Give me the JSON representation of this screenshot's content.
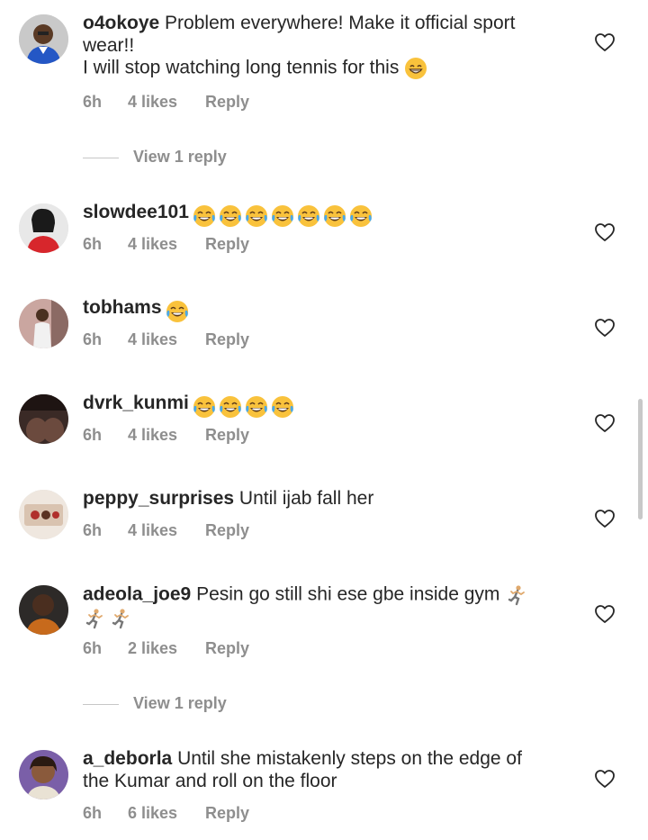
{
  "comments": [
    {
      "username": "o4okoye",
      "text_line1": "Problem everywhere! Make it official sport",
      "text_line2": "wear!!",
      "text_line3": "I will stop watching long tennis for this",
      "time": "6h",
      "likes": "4 likes",
      "reply": "Reply",
      "view_replies": "View 1 reply"
    },
    {
      "username": "slowdee101",
      "text": "",
      "time": "6h",
      "likes": "4 likes",
      "reply": "Reply"
    },
    {
      "username": "tobhams",
      "text": "",
      "time": "6h",
      "likes": "4 likes",
      "reply": "Reply"
    },
    {
      "username": "dvrk_kunmi",
      "text": "",
      "time": "6h",
      "likes": "4 likes",
      "reply": "Reply"
    },
    {
      "username": "peppy_surprises",
      "text": "Until ijab fall her",
      "time": "6h",
      "likes": "4 likes",
      "reply": "Reply"
    },
    {
      "username": "adeola_joe9",
      "text": "Pesin go still shi ese gbe inside gym",
      "time": "6h",
      "likes": "2 likes",
      "reply": "Reply",
      "view_replies": "View 1 reply"
    },
    {
      "username": "a_deborla",
      "text_line1": "Until she mistakenly steps on the edge of",
      "text_line2": "the Kumar and roll on the floor",
      "time": "6h",
      "likes": "6 likes",
      "reply": "Reply"
    }
  ],
  "icons": {
    "like": "heart-outline-icon",
    "laughing": "face-with-tears-of-joy-emoji",
    "grinning": "grinning-face-emoji",
    "runner": "person-running-emoji"
  },
  "colors": {
    "text": "#262626",
    "meta": "#8e8e8e",
    "background": "#ffffff"
  }
}
